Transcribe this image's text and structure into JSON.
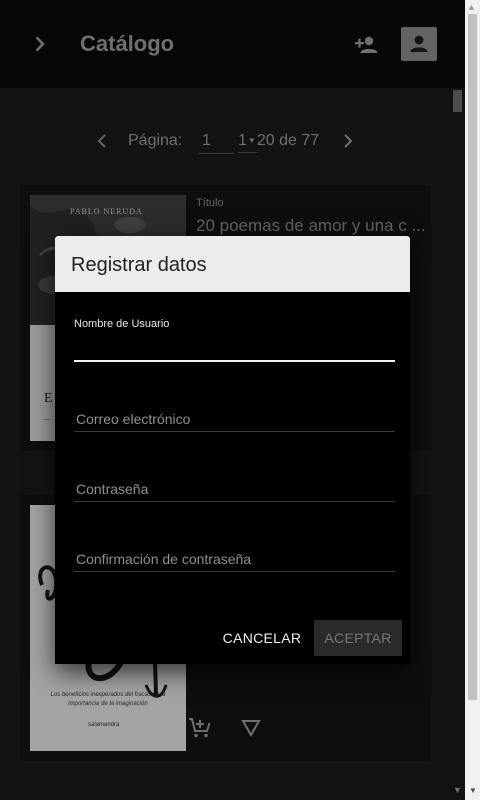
{
  "app": {
    "title": "Catálogo"
  },
  "pager": {
    "label": "Página:",
    "current_page": "1",
    "range_start": "1",
    "range_rest": "20 de 77"
  },
  "books": [
    {
      "field_label": "Título",
      "title": "20 poemas de amor y una c ...",
      "cover_author": "PABLO NERUDA",
      "cover_initial": "E"
    },
    {
      "cover_subtitle": "Los beneficios inesperados del fracaso y la importancia de la imaginación",
      "cover_publisher": "salamandra"
    }
  ],
  "dialog": {
    "title": "Registrar datos",
    "username_label": "Nombre de Usuario",
    "email_placeholder": "Correo electrónico",
    "password_placeholder": "Contraseña",
    "confirm_placeholder": "Confirmación de contraseña",
    "cancel_label": "CANCELAR",
    "accept_label": "ACEPTAR"
  },
  "icons": {
    "menu": "chevron-right-icon",
    "add_user": "person-add-icon",
    "account": "account-icon",
    "prev": "chevron-left-icon",
    "next": "chevron-right-icon",
    "cart": "add-shopping-cart-icon",
    "filter": "filter-triangle-icon"
  },
  "colors": {
    "toolbar_bg": "#0b0b0b",
    "app_bg": "#1b1b1b",
    "dialog_bg": "#000000",
    "dialog_header_bg": "#ececec",
    "muted_text": "#9a9a9a"
  }
}
